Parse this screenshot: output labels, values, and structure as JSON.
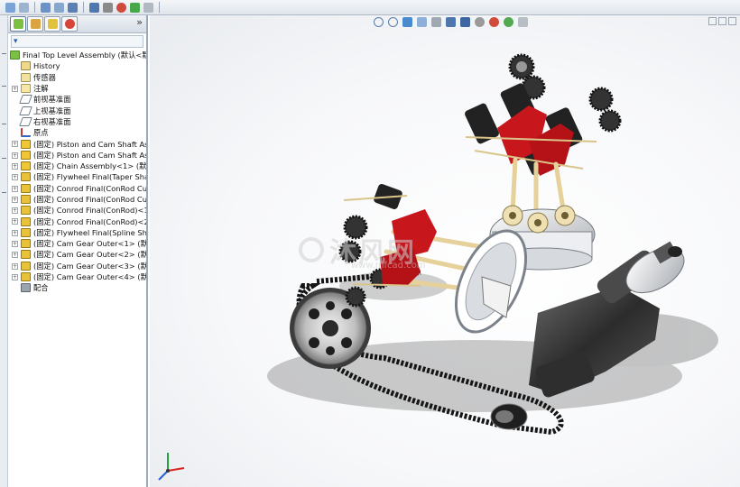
{
  "feature_tree": {
    "tabs_more": "»",
    "filter_glyph": "▾",
    "items": [
      {
        "label": "Final Top Level Assembly  (默认<默",
        "icon": "assembly",
        "expander": ""
      },
      {
        "label": "History",
        "icon": "history",
        "expander": ""
      },
      {
        "label": "传感器",
        "icon": "sensor",
        "expander": ""
      },
      {
        "label": "注解",
        "icon": "annotation",
        "expander": "+"
      },
      {
        "label": "前视基准面",
        "icon": "plane",
        "expander": ""
      },
      {
        "label": "上视基准面",
        "icon": "plane",
        "expander": ""
      },
      {
        "label": "右视基准面",
        "icon": "plane",
        "expander": ""
      },
      {
        "label": "原点",
        "icon": "origin",
        "expander": ""
      },
      {
        "label": "(固定) Piston and Cam Shaft Ass",
        "icon": "subassembly",
        "expander": "+"
      },
      {
        "label": "(固定) Piston and Cam Shaft Ass",
        "icon": "subassembly",
        "expander": "+"
      },
      {
        "label": "(固定) Chain Assembly<1> (默认",
        "icon": "subassembly",
        "expander": "+"
      },
      {
        "label": "(固定) Flywheel Final(Taper Shaf",
        "icon": "part",
        "expander": "+"
      },
      {
        "label": "(固定) Conrod Final(ConRod Cu",
        "icon": "part",
        "expander": "+"
      },
      {
        "label": "(固定) Conrod Final(ConRod Cu",
        "icon": "part",
        "expander": "+"
      },
      {
        "label": "(固定) Conrod Final(ConRod)<1",
        "icon": "part",
        "expander": "+"
      },
      {
        "label": "(固定) Conrod Final(ConRod)<2",
        "icon": "part",
        "expander": "+"
      },
      {
        "label": "(固定) Flywheel Final(Spline Shaf",
        "icon": "part",
        "expander": "+"
      },
      {
        "label": "(固定) Cam Gear Outer<1> (默认",
        "icon": "part",
        "expander": "+"
      },
      {
        "label": "(固定) Cam Gear Outer<2> (默认",
        "icon": "part",
        "expander": "+"
      },
      {
        "label": "(固定) Cam Gear Outer<3> (默认",
        "icon": "part",
        "expander": "+"
      },
      {
        "label": "(固定) Cam Gear Outer<4> (默认",
        "icon": "part",
        "expander": "+"
      },
      {
        "label": "配合",
        "icon": "mates",
        "expander": ""
      }
    ]
  },
  "watermark": {
    "text": "沐风网",
    "sub": "www.mfcad.com"
  },
  "colors": {
    "accent": "#2d5ea8",
    "part_yellow": "#e8c23a",
    "crank_gray": "#3a3a3a",
    "valve_red": "#c8161d",
    "chain_black": "#1a1a1a"
  }
}
